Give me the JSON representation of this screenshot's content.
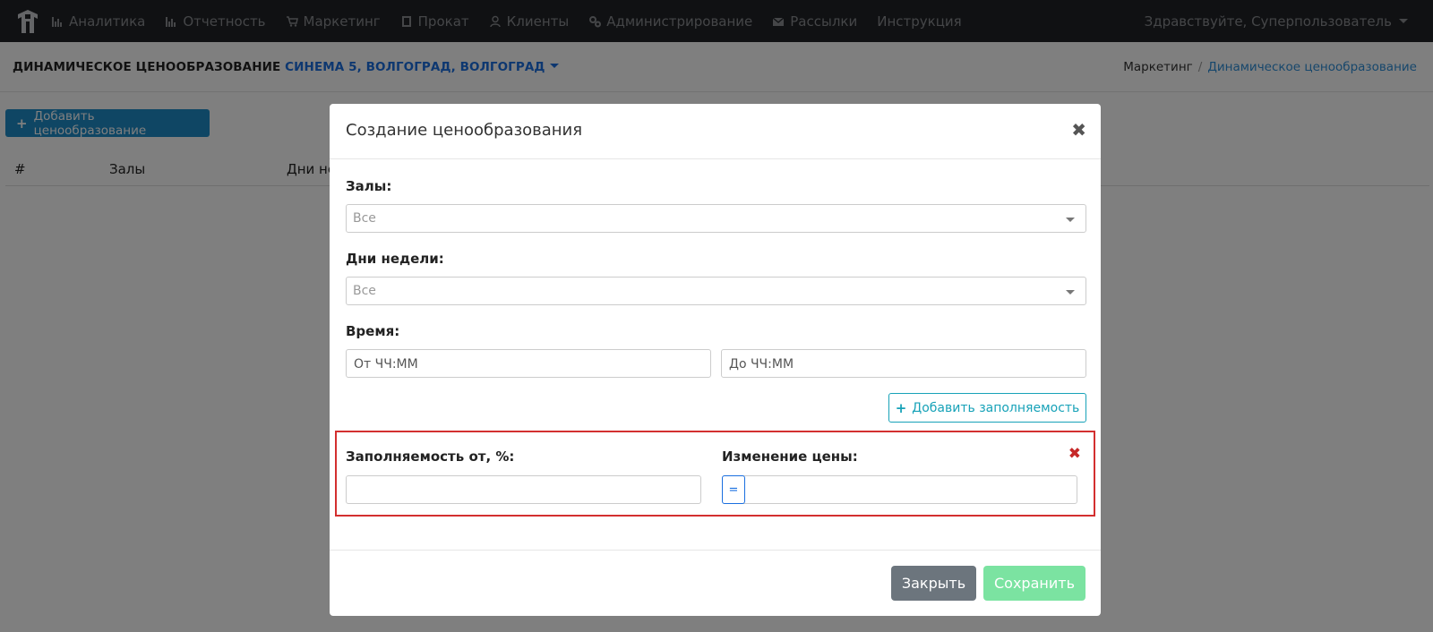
{
  "navbar": {
    "items": [
      {
        "label": "Аналитика",
        "icon": "bar-chart-icon"
      },
      {
        "label": "Отчетность",
        "icon": "bar-chart-icon"
      },
      {
        "label": "Маркетинг",
        "icon": "cart-icon"
      },
      {
        "label": "Прокат",
        "icon": "film-icon"
      },
      {
        "label": "Клиенты",
        "icon": "user-icon"
      },
      {
        "label": "Администрирование",
        "icon": "gears-icon"
      },
      {
        "label": "Рассылки",
        "icon": "envelope-icon"
      },
      {
        "label": "Инструкция",
        "icon": ""
      }
    ],
    "user_greeting": "Здравствуйте, Суперпользователь"
  },
  "header": {
    "title": "ДИНАМИЧЕСКОЕ ЦЕНООБРАЗОВАНИЕ",
    "cinema": "СИНЕМА 5, ВОЛГОГРАД, ВОЛГОГРАД",
    "breadcrumb": {
      "parent": "Маркетинг",
      "separator": "/",
      "current": "Динамическое ценообразование"
    }
  },
  "content": {
    "add_button": "Добавить ценообразование",
    "table_headers": [
      "#",
      "Залы",
      "Дни не"
    ]
  },
  "modal": {
    "title": "Создание ценообразования",
    "close_symbol": "✖",
    "halls_label": "Залы:",
    "halls_value": "Все",
    "days_label": "Дни недели:",
    "days_value": "Все",
    "time_label": "Время:",
    "time_from_placeholder": "От ЧЧ:ММ",
    "time_to_placeholder": "До ЧЧ:ММ",
    "add_occupancy_button": "Добавить заполняемость",
    "occupancy": {
      "from_label": "Заполняемость от, %:",
      "price_change_label": "Изменение цены:",
      "operator": "=",
      "remove_symbol": "✖"
    },
    "close_button": "Закрыть",
    "save_button": "Сохранить"
  },
  "colors": {
    "navbar_bg": "#202226",
    "primary": "#1f8dc9",
    "link": "#1a6fe0",
    "info": "#17a2b8",
    "highlight_border": "#d32f2f",
    "secondary": "#6c757d",
    "success_disabled": "#7be3a1"
  }
}
